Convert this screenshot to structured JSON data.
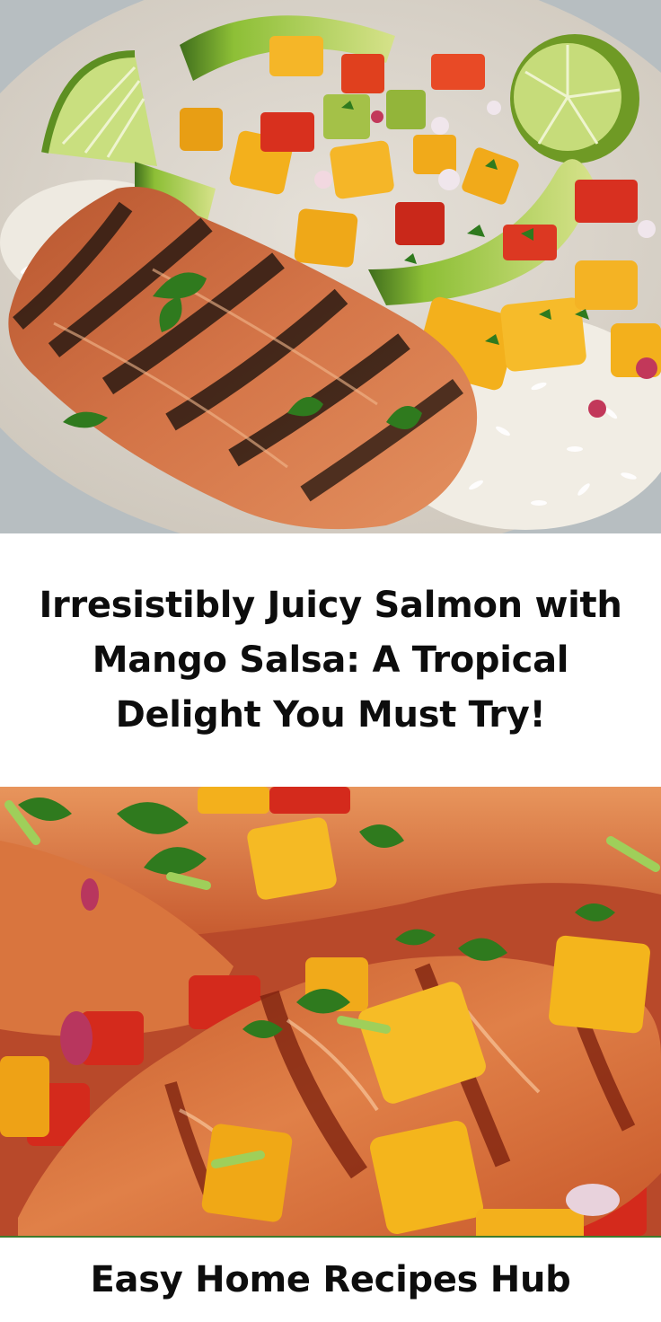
{
  "pin": {
    "title": "Irresistibly Juicy Salmon with Mango Salsa: A Tropical Delight You Must Try!",
    "brand": "Easy Home Recipes Hub"
  },
  "images": {
    "top": {
      "alt": "",
      "colors": {
        "plate": "#d9d4cc",
        "salmon": "#c9623a",
        "char": "#2a1a12",
        "rice": "#f4f1ea",
        "mango": "#f3b01c",
        "avocado": "#8fbf3a",
        "lime": "#b8d86a",
        "tomato": "#d8301e",
        "onion": "#c2385a",
        "cilantro": "#2f7a1e"
      }
    },
    "bottom": {
      "alt": "",
      "colors": {
        "salmon": "#d86a3a",
        "glaze": "#a8381a",
        "mango": "#f4b51c",
        "tomato": "#d42a1c",
        "cilantro": "#2f7a1e",
        "onion": "#b8365e"
      }
    }
  },
  "colors": {
    "background": "#ffffff",
    "text": "#0d0d0d",
    "footer_rule": "#3f7a2b"
  }
}
